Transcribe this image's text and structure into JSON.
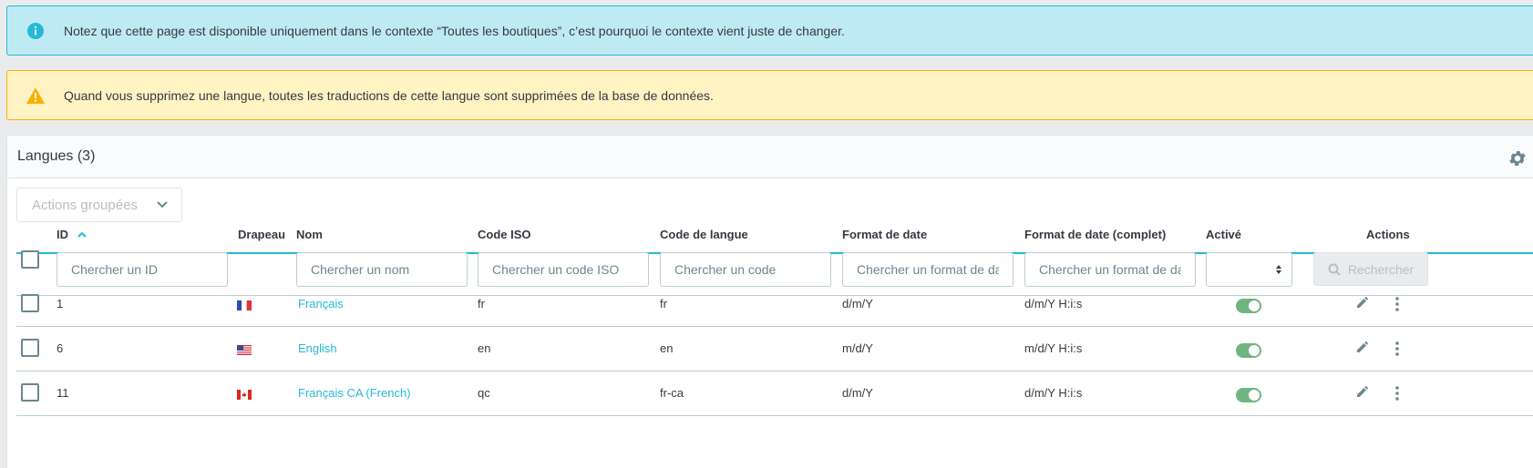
{
  "alerts": {
    "info": "Notez que cette page est disponible uniquement dans le contexte “Toutes les boutiques”, c’est pourquoi le contexte vient juste de changer.",
    "warning": "Quand vous supprimez une langue, toutes les traductions de cette langue sont supprimées de la base de données."
  },
  "card": {
    "title": "Langues (3)",
    "bulk_actions": "Actions groupées"
  },
  "columns": {
    "id": "ID",
    "flag": "Drapeau",
    "name": "Nom",
    "iso": "Code ISO",
    "lang_code": "Code de langue",
    "date_format": "Format de date",
    "date_format_full": "Format de date (complet)",
    "active": "Activé",
    "actions": "Actions"
  },
  "filters": {
    "id": "Chercher un ID",
    "name": "Chercher un nom",
    "iso": "Chercher un code ISO",
    "lang_code": "Chercher un code",
    "date_format": "Chercher un format de date",
    "date_format_full": "Chercher un format de date",
    "search_button": "Rechercher"
  },
  "rows": [
    {
      "id": "1",
      "flag": "fr",
      "name": "Français",
      "iso": "fr",
      "lang_code": "fr",
      "date_format": "d/m/Y",
      "date_format_full": "d/m/Y H:i:s",
      "active": true
    },
    {
      "id": "6",
      "flag": "us",
      "name": "English",
      "iso": "en",
      "lang_code": "en",
      "date_format": "m/d/Y",
      "date_format_full": "m/d/Y H:i:s",
      "active": true
    },
    {
      "id": "11",
      "flag": "ca",
      "name": "Français CA (French)",
      "iso": "qc",
      "lang_code": "fr-ca",
      "date_format": "d/m/Y",
      "date_format_full": "d/m/Y H:i:s",
      "active": true
    }
  ],
  "colors": {
    "primary": "#25b9d7",
    "info_bg": "#beeaf3",
    "warning_bg": "#fff3c4",
    "warning_icon": "#fab000",
    "success": "#70b580"
  }
}
